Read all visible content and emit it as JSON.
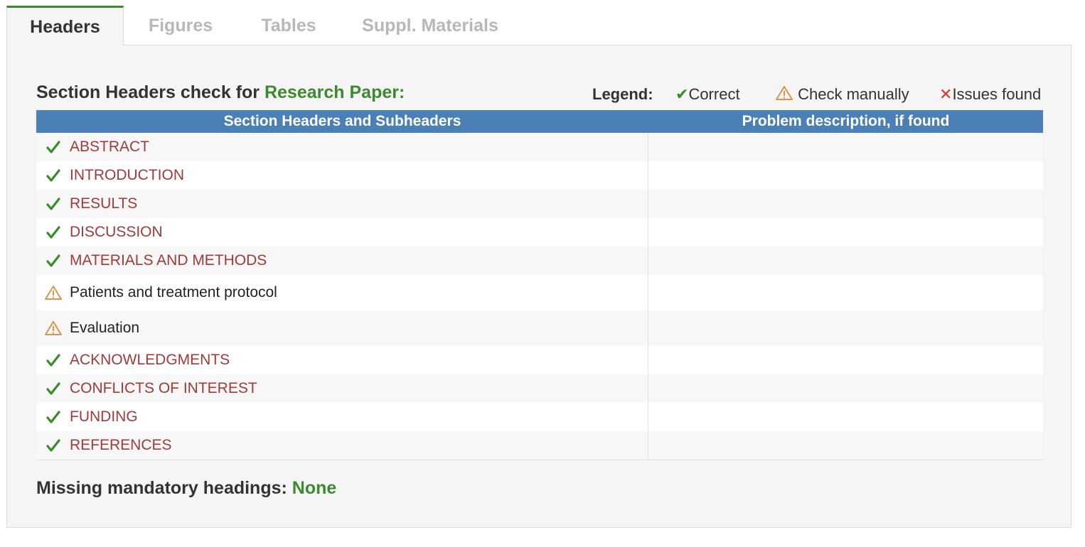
{
  "tabs": [
    {
      "label": "Headers",
      "active": true
    },
    {
      "label": "Figures",
      "active": false
    },
    {
      "label": "Tables",
      "active": false
    },
    {
      "label": "Suppl. Materials",
      "active": false
    }
  ],
  "section": {
    "title_prefix": "Section Headers check for",
    "paper_type": "Research Paper:"
  },
  "legend": {
    "label": "Legend:",
    "correct": "Correct",
    "check_manually": "Check manually",
    "issues_found": "Issues found"
  },
  "table": {
    "col_headers": [
      "Section Headers and Subheaders",
      "Problem description, if found"
    ],
    "rows": [
      {
        "status": "correct",
        "name": "ABSTRACT",
        "kind": "major",
        "problem": ""
      },
      {
        "status": "correct",
        "name": "INTRODUCTION",
        "kind": "major",
        "problem": ""
      },
      {
        "status": "correct",
        "name": "RESULTS",
        "kind": "major",
        "problem": ""
      },
      {
        "status": "correct",
        "name": "DISCUSSION",
        "kind": "major",
        "problem": ""
      },
      {
        "status": "correct",
        "name": "MATERIALS AND METHODS",
        "kind": "major",
        "problem": ""
      },
      {
        "status": "check",
        "name": "Patients and treatment protocol",
        "kind": "sub",
        "problem": ""
      },
      {
        "status": "check",
        "name": "Evaluation",
        "kind": "sub",
        "problem": ""
      },
      {
        "status": "correct",
        "name": "ACKNOWLEDGMENTS",
        "kind": "major",
        "problem": ""
      },
      {
        "status": "correct",
        "name": "CONFLICTS OF INTEREST",
        "kind": "major",
        "problem": ""
      },
      {
        "status": "correct",
        "name": "FUNDING",
        "kind": "major",
        "problem": ""
      },
      {
        "status": "correct",
        "name": "REFERENCES",
        "kind": "major",
        "problem": ""
      }
    ]
  },
  "missing": {
    "label": "Missing mandatory headings:",
    "value": "None"
  },
  "colors": {
    "green": "#3c8a2e",
    "header_blue": "#4a80b5",
    "major_red": "#a13a3a",
    "warn_orange": "#d9944f",
    "error_red": "#e0312b"
  }
}
